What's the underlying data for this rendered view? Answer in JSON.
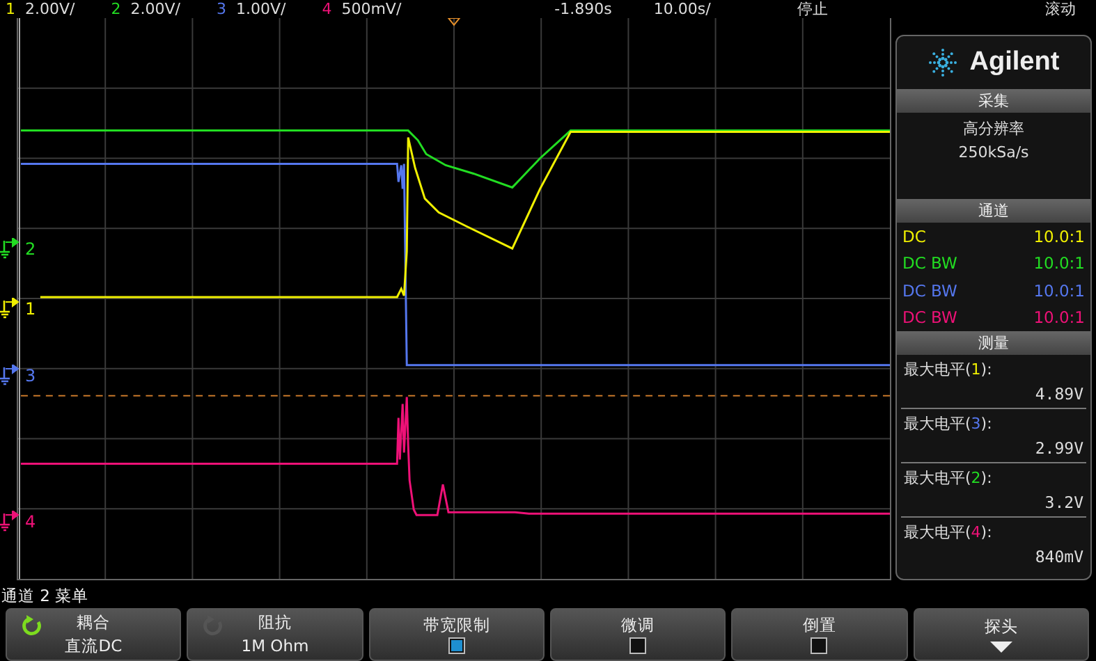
{
  "top_bar": {
    "channels": [
      {
        "number": "1",
        "scale": "2.00V/",
        "color": "#f0f000"
      },
      {
        "number": "2",
        "scale": "2.00V/",
        "color": "#22dd22"
      },
      {
        "number": "3",
        "scale": "1.00V/",
        "color": "#5577ee"
      },
      {
        "number": "4",
        "scale": "500mV/",
        "color": "#ee1177"
      }
    ],
    "delay": "-1.890s",
    "timebase": "10.00s/",
    "run_state": "停止",
    "mode": "滚动"
  },
  "markers": [
    {
      "number": "2",
      "color": "#22dd22"
    },
    {
      "number": "1",
      "color": "#f0f000"
    },
    {
      "number": "3",
      "color": "#5577ee"
    },
    {
      "number": "4",
      "color": "#ee1177"
    }
  ],
  "side_panel": {
    "brand": "Agilent",
    "acquisition": {
      "title": "采集",
      "mode": "高分辨率",
      "rate": "250kSa/s"
    },
    "channels": {
      "title": "通道",
      "rows": [
        {
          "coupling": "DC",
          "probe": "10.0:1",
          "color": "#f0f000"
        },
        {
          "coupling": "DC BW",
          "probe": "10.0:1",
          "color": "#22dd22"
        },
        {
          "coupling": "DC BW",
          "probe": "10.0:1",
          "color": "#5577ee"
        },
        {
          "coupling": "DC BW",
          "probe": "10.0:1",
          "color": "#ee1177"
        }
      ]
    },
    "measurements": {
      "title": "测量",
      "rows": [
        {
          "prefix": "最大电平(",
          "channel": "1",
          "suffix": "):",
          "value": "4.89V",
          "color": "#f0f000"
        },
        {
          "prefix": "最大电平(",
          "channel": "3",
          "suffix": "):",
          "value": "2.99V",
          "color": "#5577ee"
        },
        {
          "prefix": "最大电平(",
          "channel": "2",
          "suffix": "):",
          "value": "3.2V",
          "color": "#22dd22"
        },
        {
          "prefix": "最大电平(",
          "channel": "4",
          "suffix": "):",
          "value": "840mV",
          "color": "#ee1177"
        }
      ]
    }
  },
  "menu_title": "通道 2 菜单",
  "softkeys": [
    {
      "kind": "value",
      "title": "耦合",
      "value": "直流DC",
      "knob_active": true
    },
    {
      "kind": "value",
      "title": "阻抗",
      "value": "1M Ohm",
      "knob_active": false
    },
    {
      "kind": "checkbox",
      "title": "带宽限制",
      "checked": true
    },
    {
      "kind": "checkbox",
      "title": "微调",
      "checked": false
    },
    {
      "kind": "checkbox",
      "title": "倒置",
      "checked": false
    },
    {
      "kind": "more",
      "title": "探头"
    }
  ]
}
